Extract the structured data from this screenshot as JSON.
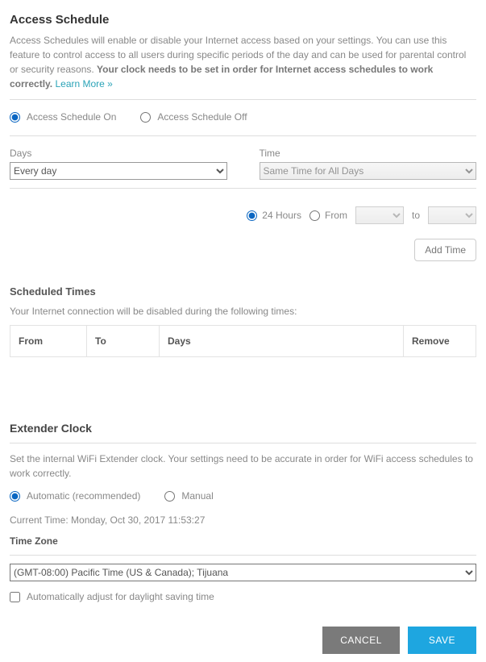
{
  "access_schedule": {
    "title": "Access Schedule",
    "desc_part1": "Access Schedules will enable or disable your Internet access based on your settings. You can use this feature to control access to all users during specific periods of the day and can be used for parental control or security reasons. ",
    "desc_bold": "Your clock needs to be set in order for Internet access schedules to work correctly.",
    "learn_more": "Learn More »",
    "radio": {
      "on_label": "Access Schedule On",
      "off_label": "Access Schedule Off",
      "selected": "on"
    },
    "days": {
      "label": "Days",
      "value": "Every day"
    },
    "time": {
      "label": "Time",
      "value": "Same Time for All Days"
    },
    "hours": {
      "h24_label": "24 Hours",
      "from_label": "From",
      "to_label": "to",
      "selected": "24"
    },
    "add_time_label": "Add Time"
  },
  "scheduled_times": {
    "title": "Scheduled Times",
    "desc": "Your Internet connection will be disabled during the following times:",
    "columns": {
      "from": "From",
      "to": "To",
      "days": "Days",
      "remove": "Remove"
    }
  },
  "extender_clock": {
    "title": "Extender Clock",
    "desc": "Set the internal WiFi Extender clock. Your settings need to be accurate in order for WiFi access schedules to work correctly.",
    "mode": {
      "auto_label": "Automatic (recommended)",
      "manual_label": "Manual",
      "selected": "auto"
    },
    "current_time_prefix": "Current Time: ",
    "current_time_value": "Monday, Oct 30, 2017 11:53:27",
    "tz_label": "Time Zone",
    "tz_value": "(GMT-08:00) Pacific Time (US & Canada); Tijuana",
    "dst_label": "Automatically adjust for daylight saving time",
    "dst_checked": false
  },
  "footer": {
    "cancel": "CANCEL",
    "save": "SAVE"
  }
}
